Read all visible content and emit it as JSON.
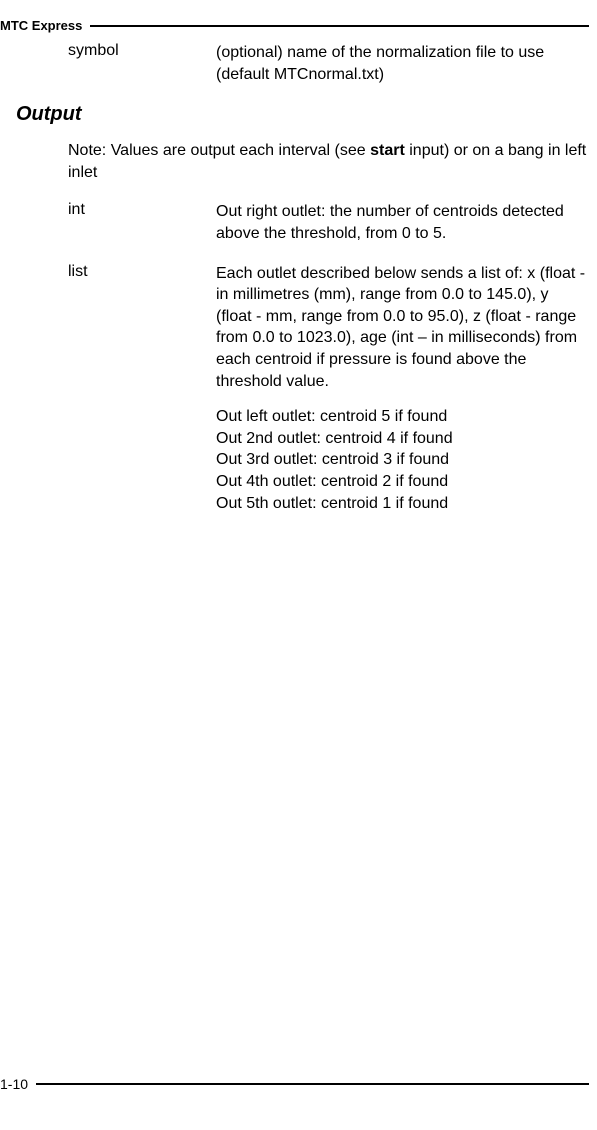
{
  "header": {
    "title": "MTC Express"
  },
  "row_symbol": {
    "term": "symbol",
    "desc": "(optional) name of the normalization file to use (default MTCnormal.txt)"
  },
  "output_heading": "Output",
  "note": {
    "text_pre": "Note: Values are output each interval (see ",
    "bold": "start",
    "text_post": " input) or on a bang in left inlet"
  },
  "row_int": {
    "term": "int",
    "desc": "Out right outlet: the number of centroids detected above the threshold, from 0 to 5."
  },
  "row_list": {
    "term": "list",
    "desc1": "Each outlet described below sends a list of: x (float - in millimetres (mm), range from 0.0 to 145.0), y (float - mm,  range from 0.0 to 95.0), z (float - range from 0.0 to 1023.0), age (int – in milliseconds) from each centroid if pressure is found above the threshold value.",
    "out1": "Out left outlet: centroid 5 if found",
    "out2": "Out 2nd outlet: centroid 4 if found",
    "out3": "Out 3rd outlet: centroid 3 if found",
    "out4": "Out 4th outlet: centroid 2 if found",
    "out5": "Out 5th outlet: centroid 1 if found"
  },
  "footer": {
    "page": "1-10"
  }
}
